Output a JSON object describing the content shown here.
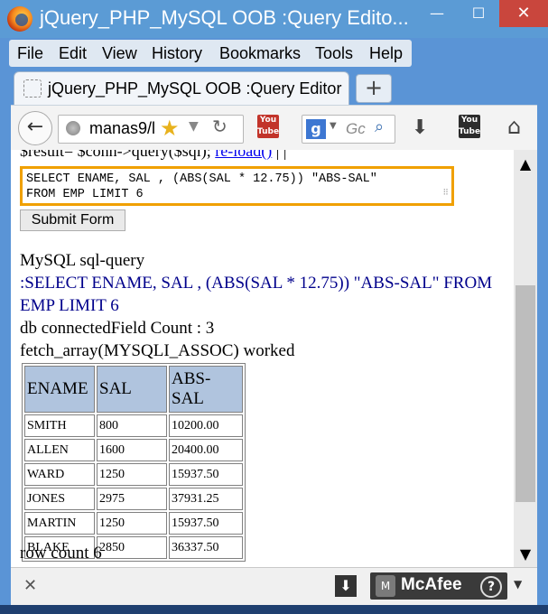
{
  "window": {
    "title": "jQuery_PHP_MySQL OOB :Query Edito...",
    "min": "—",
    "max": "☐",
    "close": "✕"
  },
  "menu": [
    "File",
    "Edit",
    "View",
    "History",
    "Bookmarks",
    "Tools",
    "Help"
  ],
  "tab": {
    "label": "jQuery_PHP_MySQL OOB :Query Editor",
    "new_tab": "+"
  },
  "nav": {
    "back": "←",
    "url": "manas9/l",
    "star": "★",
    "dropdown": "▼",
    "reload": "↻",
    "youtube1": "You Tube",
    "search_engine": "g",
    "search_dropdown": "▼",
    "search_placeholder": "Gc",
    "search_icon": "⌕",
    "download": "⬇",
    "youtube2": "You Tube",
    "home": "⌂"
  },
  "content": {
    "cut_line_prefix": "$result= $conn->query($sql); ",
    "cut_line_link": "re-load()",
    "cut_line_suffix": " | |",
    "sql_text": "SELECT ENAME, SAL , (ABS(SAL * 12.75)) \"ABS-SAL\"\nFROM EMP LIMIT 6",
    "resize_grip": "⠿",
    "submit_label": "Submit Form",
    "heading": "MySQL sql-query",
    "query_line1": ":SELECT ENAME, SAL , (ABS(SAL * 12.75)) \"ABS-SAL\" FROM",
    "query_line2": "EMP LIMIT 6",
    "db_line": "db connectedField Count : 3",
    "fetch_line": "fetch_array(MYSQLI_ASSOC) worked",
    "table": {
      "headers": [
        "ENAME",
        "SAL",
        "ABS-SAL"
      ],
      "rows": [
        [
          "SMITH",
          "800",
          "10200.00"
        ],
        [
          "ALLEN",
          "1600",
          "20400.00"
        ],
        [
          "WARD",
          "1250",
          "15937.50"
        ],
        [
          "JONES",
          "2975",
          "37931.25"
        ],
        [
          "MARTIN",
          "1250",
          "15937.50"
        ],
        [
          "BLAKE",
          "2850",
          "36337.50"
        ]
      ]
    },
    "row_count": "row count 6"
  },
  "scrollbar": {
    "up": "▲",
    "down": "▼"
  },
  "addon_bar": {
    "close": "✕",
    "download": "⬇",
    "mcafee": "McAfee",
    "mcafee_shield": "M",
    "mcafee_help": "?",
    "dropdown": "▼"
  }
}
